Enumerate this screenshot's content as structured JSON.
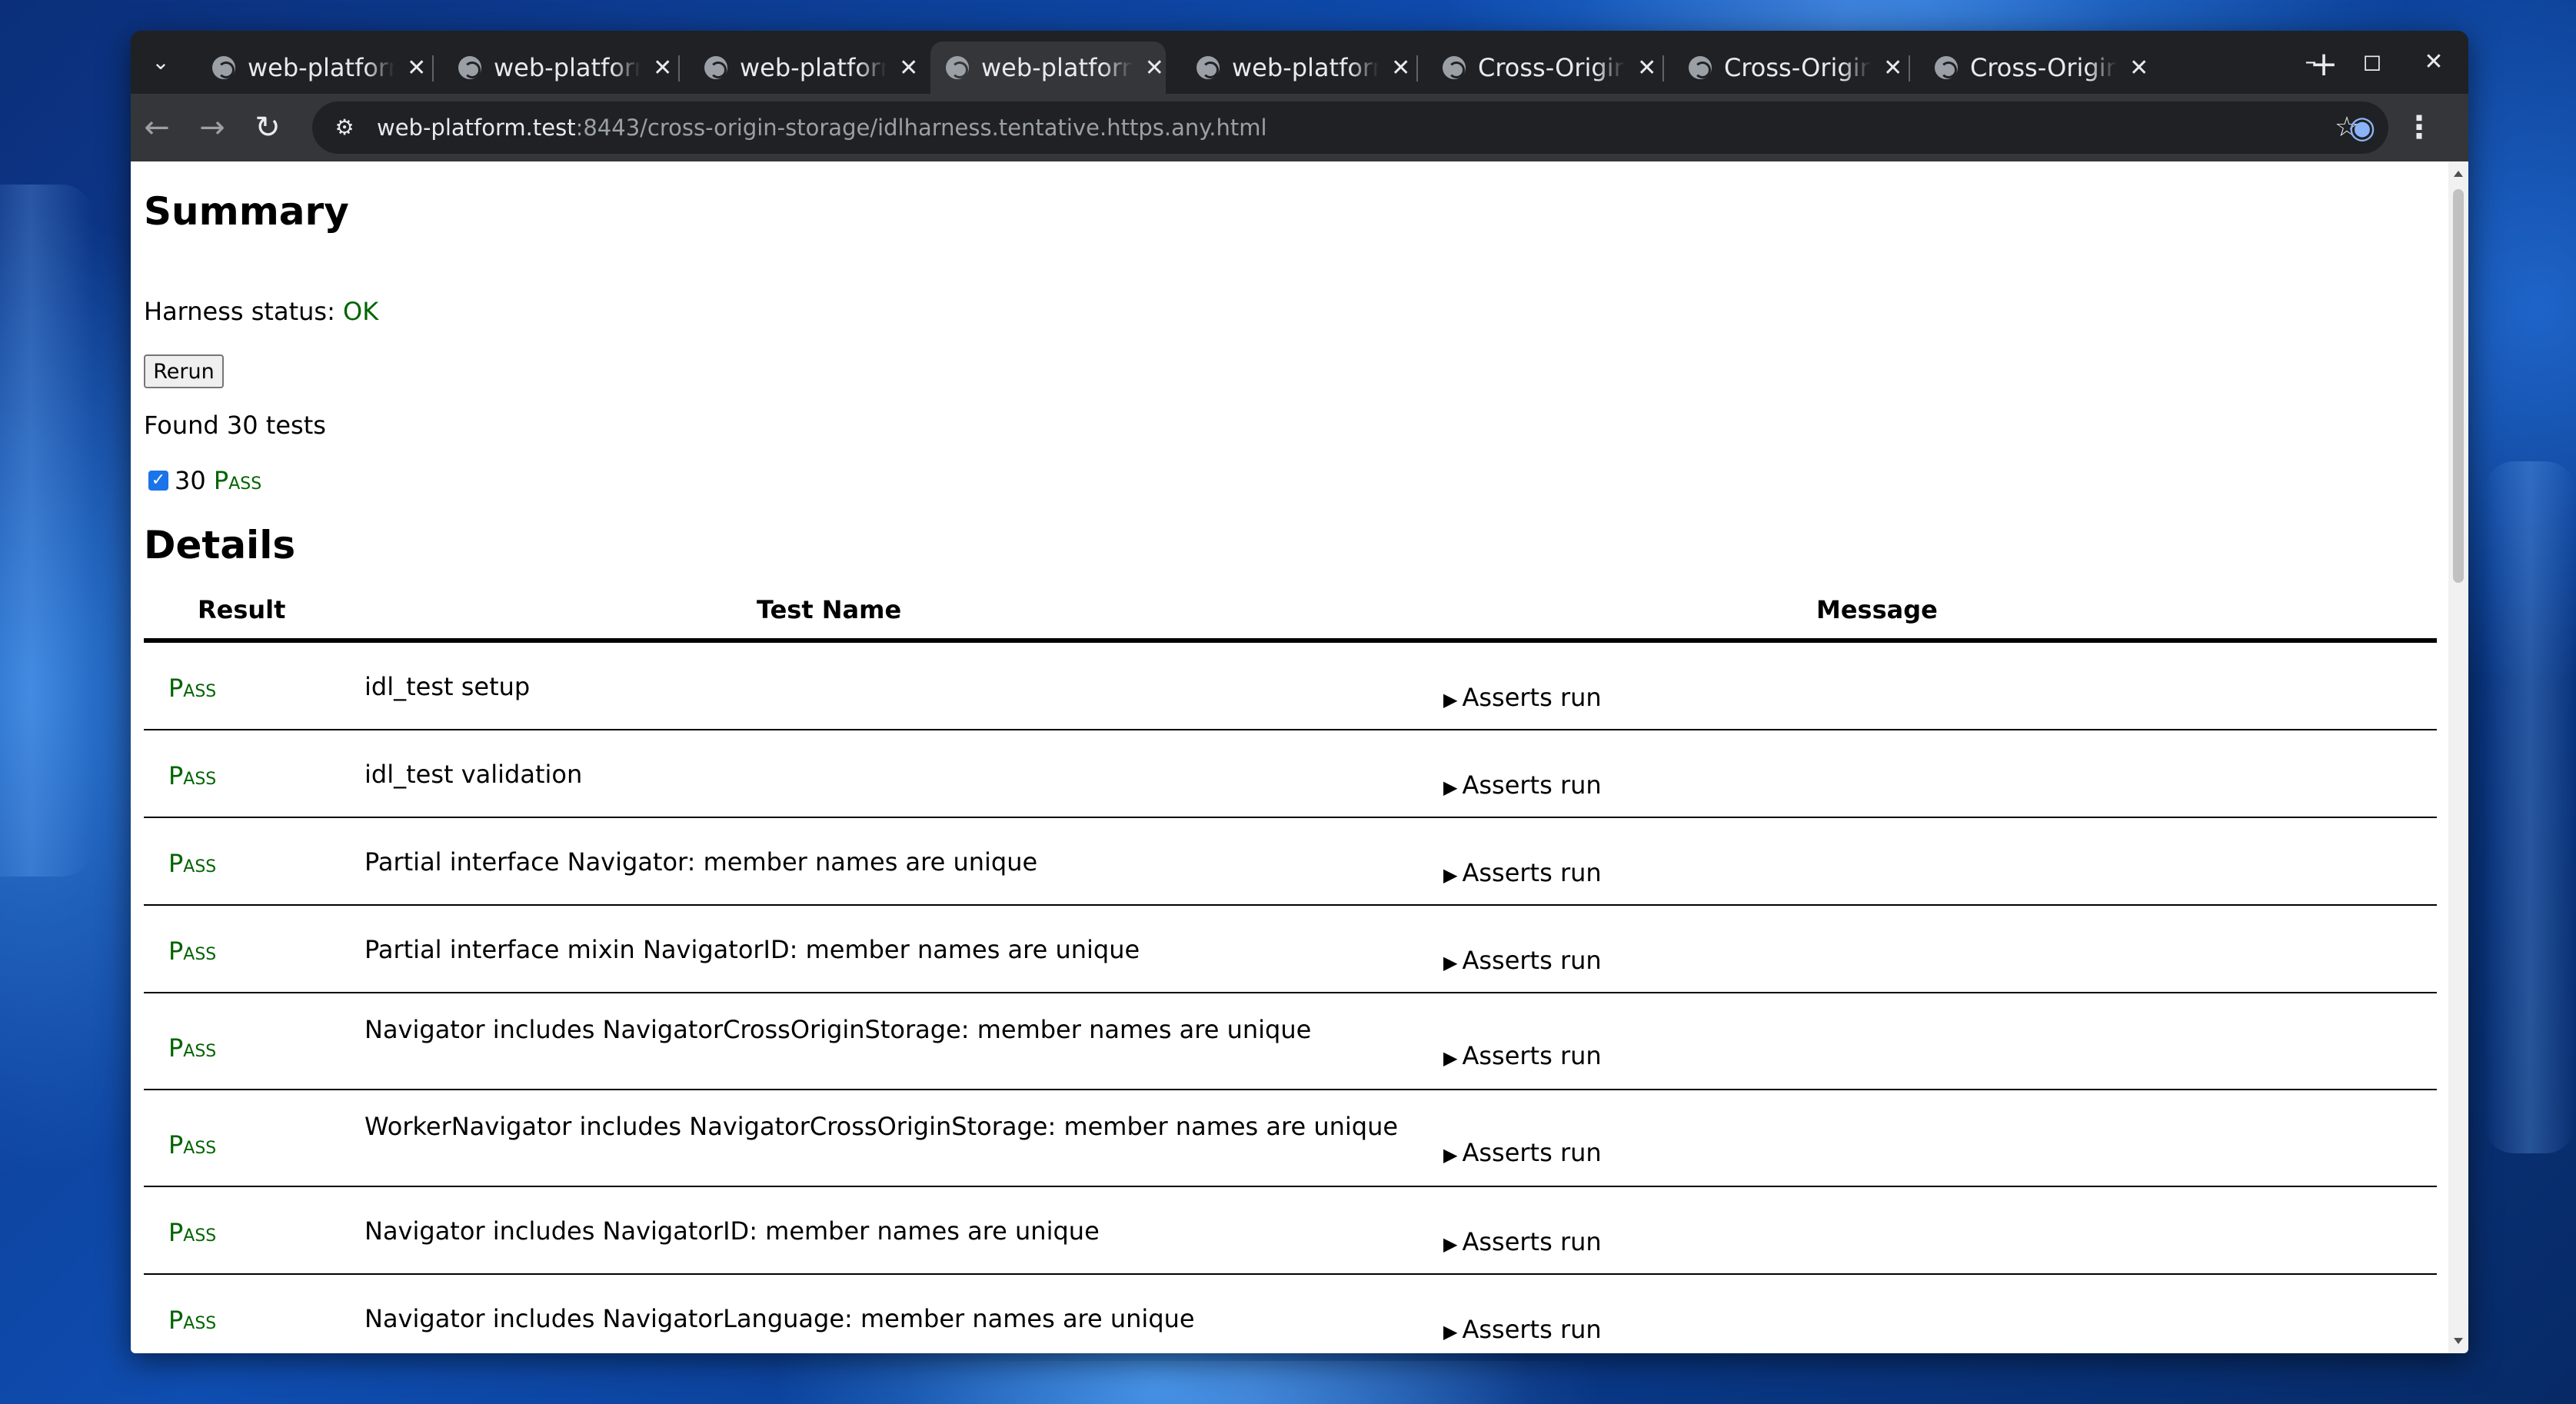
{
  "browser": {
    "tabs": [
      {
        "title": "web-platform.test",
        "active": false
      },
      {
        "title": "web-platform.test",
        "active": false
      },
      {
        "title": "web-platform.test",
        "active": false
      },
      {
        "title": "web-platform.test",
        "active": true
      },
      {
        "title": "web-platform.test",
        "active": false
      },
      {
        "title": "Cross-Origin Storage",
        "active": false
      },
      {
        "title": "Cross-Origin Storage",
        "active": false
      },
      {
        "title": "Cross-Origin Storage",
        "active": false
      }
    ],
    "close_glyph": "✕",
    "new_tab_glyph": "+",
    "tab_search_glyph": "⌄",
    "window_controls": {
      "minimize": "–",
      "maximize": "◻",
      "close": "✕"
    },
    "nav": {
      "back": "←",
      "forward": "→",
      "reload": "↻"
    },
    "url_host": "web-platform.test",
    "url_rest": ":8443/cross-origin-storage/idlharness.tentative.https.any.html",
    "star_glyph": "☆",
    "profile_glyph": "◉",
    "menu_glyph": "⋮",
    "site_info_glyph": "⚙"
  },
  "page": {
    "summary_heading": "Summary",
    "harness_label": "Harness status: ",
    "harness_status": "OK",
    "rerun_label": "Rerun",
    "found_text": "Found 30 tests",
    "pass_count": "30",
    "pass_label": "Pass",
    "details_heading": "Details",
    "columns": {
      "result": "Result",
      "test_name": "Test Name",
      "message": "Message"
    },
    "rows": [
      {
        "result": "Pass",
        "name": "idl_test setup",
        "message": "Asserts run"
      },
      {
        "result": "Pass",
        "name": "idl_test validation",
        "message": "Asserts run"
      },
      {
        "result": "Pass",
        "name": "Partial interface Navigator: member names are unique",
        "message": "Asserts run"
      },
      {
        "result": "Pass",
        "name": "Partial interface mixin NavigatorID: member names are unique",
        "message": "Asserts run"
      },
      {
        "result": "Pass",
        "name": "Navigator includes NavigatorCrossOriginStorage: member names are unique",
        "message": "Asserts run"
      },
      {
        "result": "Pass",
        "name": "WorkerNavigator includes NavigatorCrossOriginStorage: member names are unique",
        "message": "Asserts run"
      },
      {
        "result": "Pass",
        "name": "Navigator includes NavigatorID: member names are unique",
        "message": "Asserts run"
      },
      {
        "result": "Pass",
        "name": "Navigator includes NavigatorLanguage: member names are unique",
        "message": "Asserts run"
      }
    ],
    "expander_glyph": "▶"
  },
  "colors": {
    "pass": "#006400",
    "chrome_dark": "#202124",
    "toolbar": "#35363a",
    "accent": "#1a73e8"
  }
}
